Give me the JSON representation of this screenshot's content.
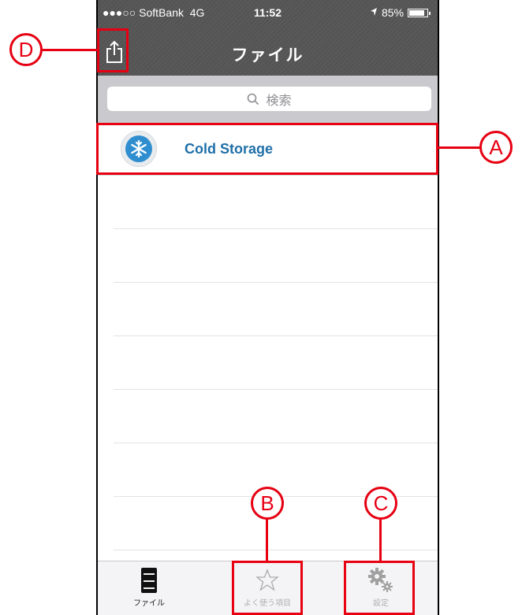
{
  "status_bar": {
    "carrier": "●●●○○ SoftBank",
    "network": "4G",
    "time": "11:52",
    "battery": "85%",
    "battery_level": 0.85
  },
  "nav": {
    "title": "ファイル",
    "share_icon": "share-icon"
  },
  "search": {
    "placeholder": "検索",
    "icon": "search-icon"
  },
  "files": [
    {
      "name": "Cold Storage",
      "icon": "snowflake-icon"
    }
  ],
  "tabbar": {
    "tabs": [
      {
        "label": "ファイル",
        "icon": "file-cabinet-icon",
        "active": true
      },
      {
        "label": "よく使う項目",
        "icon": "star-icon",
        "active": false
      },
      {
        "label": "設定",
        "icon": "gear-icon",
        "active": false
      }
    ]
  },
  "callouts": {
    "a": "A",
    "b": "B",
    "c": "C",
    "d": "D"
  },
  "colors": {
    "callout": "#e60012",
    "link": "#1f6fa8",
    "navbar": "#585858"
  }
}
